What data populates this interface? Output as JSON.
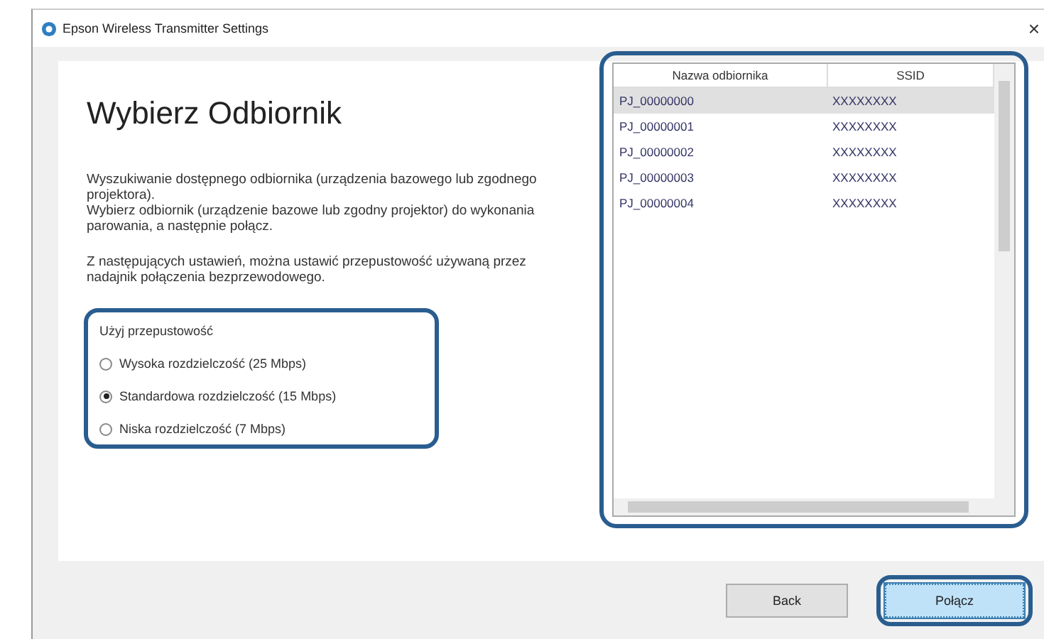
{
  "window": {
    "title": "Epson Wireless Transmitter Settings",
    "close": "×"
  },
  "heading": "Wybierz Odbiornik",
  "paragraphs": [
    "Wyszukiwanie dostępnego odbiornika (urządzenia bazowego lub zgodnego projektora).\nWybierz odbiornik (urządzenie bazowe lub zgodny projektor) do wykonania parowania, a następnie połącz.",
    "Z następujących ustawień, można ustawić przepustowość używaną przez nadajnik połączenia bezprzewodowego."
  ],
  "bandwidth": {
    "label": "Użyj przepustowość",
    "highlighted": true,
    "options": [
      {
        "label": "Wysoka rozdzielczość (25 Mbps)",
        "selected": false
      },
      {
        "label": "Standardowa rozdzielczość (15 Mbps)",
        "selected": true
      },
      {
        "label": "Niska rozdzielczość (7 Mbps)",
        "selected": false
      }
    ]
  },
  "receivers": {
    "highlighted": true,
    "columns": [
      "Nazwa odbiornika",
      "SSID"
    ],
    "rows": [
      {
        "name": "PJ_00000000",
        "ssid": "XXXXXXXX",
        "selected": true
      },
      {
        "name": "PJ_00000001",
        "ssid": "XXXXXXXX",
        "selected": false
      },
      {
        "name": "PJ_00000002",
        "ssid": "XXXXXXXX",
        "selected": false
      },
      {
        "name": "PJ_00000003",
        "ssid": "XXXXXXXX",
        "selected": false
      },
      {
        "name": "PJ_00000004",
        "ssid": "XXXXXXXX",
        "selected": false
      }
    ]
  },
  "buttons": [
    {
      "label": "Back",
      "kind": "normal",
      "highlighted": false
    },
    {
      "label": "Połącz",
      "kind": "default",
      "highlighted": true
    }
  ]
}
